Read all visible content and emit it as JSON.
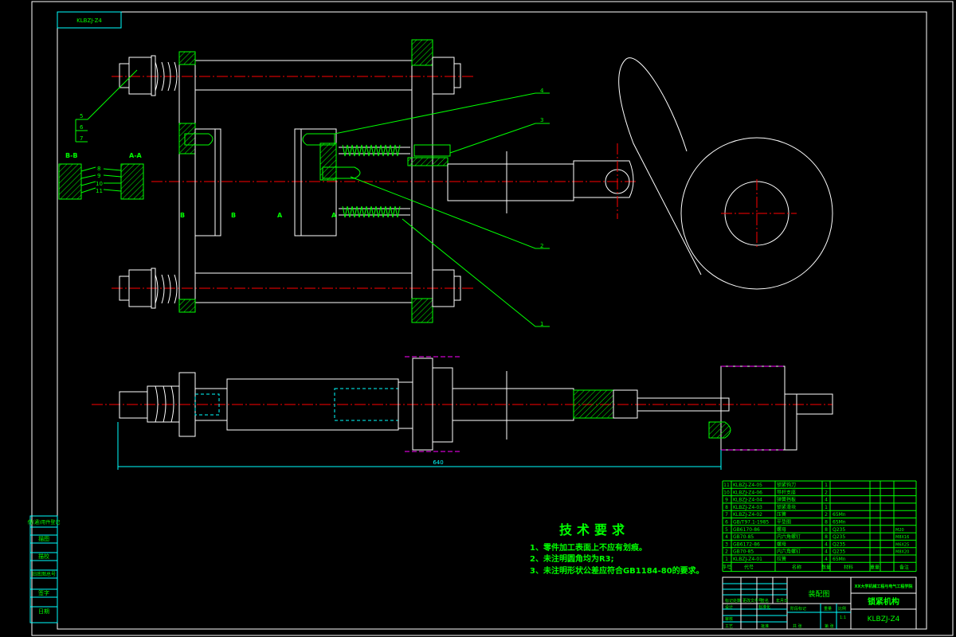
{
  "drawing": {
    "corner_label": "KLBZJ-Z4",
    "dimension_overall": "640",
    "section_labels": {
      "bb": "B-B",
      "aa": "A-A",
      "b_left": "B",
      "b_right": "B",
      "a_left": "A",
      "a_right": "A"
    },
    "balloons": [
      "1",
      "2",
      "3",
      "4",
      "5",
      "6",
      "7"
    ],
    "section_balloons": [
      "8",
      "9",
      "10",
      "11"
    ]
  },
  "tech_requirements": {
    "title": "技术要求",
    "items": [
      "1、零件加工表面上不应有划痕。",
      "2、未注明圆角均为R3;",
      "3、未注明形状公差应符合GB1184-80的要求。"
    ]
  },
  "parts_list": {
    "header": [
      "序号",
      "代号",
      "名称",
      "数量",
      "材料",
      "重量",
      "",
      "备注"
    ],
    "rows": [
      {
        "no": "11",
        "code": "KLBZJ-Z4-05",
        "name": "锁紧钩刀",
        "qty": "1",
        "mat": "",
        "note": ""
      },
      {
        "no": "10",
        "code": "KLBZJ-Z4-06",
        "name": "导杆支座",
        "qty": "2",
        "mat": "",
        "note": ""
      },
      {
        "no": "9",
        "code": "KLBZJ-Z4-04",
        "name": "弹簧挡板",
        "qty": "4",
        "mat": "",
        "note": ""
      },
      {
        "no": "8",
        "code": "KLBZJ-Z4-03",
        "name": "锁紧滑块",
        "qty": "1",
        "mat": "",
        "note": ""
      },
      {
        "no": "7",
        "code": "KLBZJ-Z4-02",
        "name": "压簧",
        "qty": "2",
        "mat": "65Mn",
        "note": ""
      },
      {
        "no": "6",
        "code": "GB/T97.1-1985",
        "name": "平垫圈",
        "qty": "8",
        "mat": "65Mn",
        "note": ""
      },
      {
        "no": "5",
        "code": "GB6170-86",
        "name": "螺母",
        "qty": "8",
        "mat": "Q235",
        "note": "M20"
      },
      {
        "no": "4",
        "code": "GB70-85",
        "name": "内六角螺钉",
        "qty": "8",
        "mat": "Q235",
        "note": "M8X16"
      },
      {
        "no": "3",
        "code": "GB6172-86",
        "name": "螺母",
        "qty": "4",
        "mat": "Q235",
        "note": "M6X25"
      },
      {
        "no": "2",
        "code": "GB70-85",
        "name": "内六角螺钉",
        "qty": "4",
        "mat": "Q235",
        "note": "M8X20"
      },
      {
        "no": "1",
        "code": "KLBZJ-Z4-01",
        "name": "拉簧",
        "qty": "4",
        "mat": "65Mn",
        "note": ""
      }
    ]
  },
  "title_block": {
    "drawing_type": "装配图",
    "school": "XX大学机械工程与电气工程学院",
    "title": "锁紧机构",
    "drawing_no": "KLBZJ-Z4",
    "labels": [
      "标记",
      "处数",
      "分区",
      "更改文件号",
      "签名",
      "年月日",
      "设计",
      "标准化",
      "审核",
      "工艺",
      "批准",
      "阶段标记",
      "重量",
      "比例",
      "共 张",
      "第 张"
    ],
    "scale": "1:1"
  },
  "side_column": [
    "借(通)用件登记",
    "描图",
    "描校",
    "旧底图总号",
    "签字",
    "日期"
  ]
}
